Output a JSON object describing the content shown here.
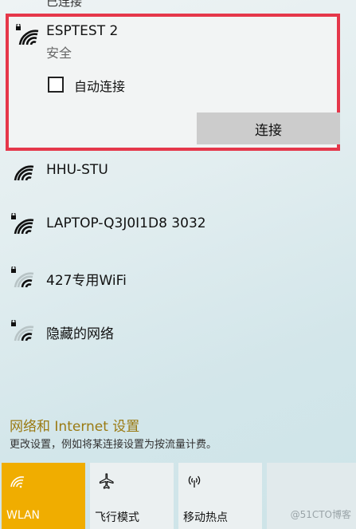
{
  "top_partial": "已连接",
  "selected_network": {
    "name": "ESPTEST 2",
    "status": "安全",
    "auto_connect_label": "自动连接",
    "auto_connect_checked": false,
    "connect_label": "连接"
  },
  "networks": [
    {
      "name": "HHU-STU",
      "secured": false,
      "signal_bars": 4
    },
    {
      "name": "LAPTOP-Q3J0I1D8 3032",
      "secured": true,
      "signal_bars": 4
    },
    {
      "name": "427专用WiFi",
      "secured": true,
      "signal_bars": 2
    },
    {
      "name": "隐藏的网络",
      "secured": true,
      "signal_bars": 2
    }
  ],
  "settings": {
    "link": "网络和 Internet 设置",
    "description": "更改设置，例如将某连接设置为按流量计费。"
  },
  "quick_actions": [
    {
      "label": "WLAN",
      "icon": "wifi-icon",
      "active": true
    },
    {
      "label": "飞行模式",
      "icon": "airplane-icon",
      "active": false
    },
    {
      "label": "移动热点",
      "icon": "hotspot-icon",
      "active": false
    }
  ],
  "watermark": "@51CTO博客",
  "colors": {
    "accent": "#f0ad00",
    "highlight_border": "#e5374a",
    "settings_link": "#9a7a12"
  }
}
